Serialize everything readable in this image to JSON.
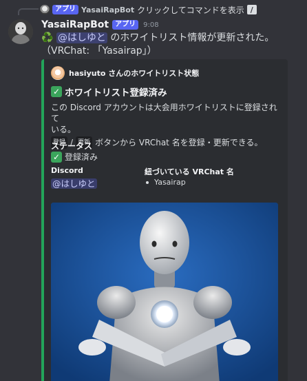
{
  "reply": {
    "badge": "アプリ",
    "name": "YasaiRapBot",
    "text": "クリックしてコマンドを表示",
    "cmd_icon": "slash-command-icon"
  },
  "message": {
    "username": "YasaiRapBot",
    "badge": "アプリ",
    "time": "9:08",
    "recycle_icon": "recycle-icon",
    "mention": "@はしゆと",
    "line1_rest": " のホワイトリスト情報が更新された。",
    "line2": "（VRChat: 「Yasairap」）"
  },
  "embed": {
    "accent_color": "#23a55a",
    "author": "hasiyuto さんのホワイトリスト状態",
    "title": "ホワイトリスト登録済み",
    "description": {
      "line1": "この Discord アカウントは大会用ホワイトリストに登録されて",
      "line2": "いる。",
      "code1": "登録",
      "sep": "/",
      "code2": "更新",
      "line3_rest": "ボタンから VRChat 名を登録・更新できる。"
    },
    "fields": {
      "status_name": "ステータス",
      "status_value": "登録済み",
      "discord_name": "Discord",
      "discord_value": "@はしゆと",
      "vrchat_name": "紐づいている VRChat 名",
      "vrchat_values": [
        "Yasairap"
      ]
    },
    "image_alt": "robot-image"
  }
}
